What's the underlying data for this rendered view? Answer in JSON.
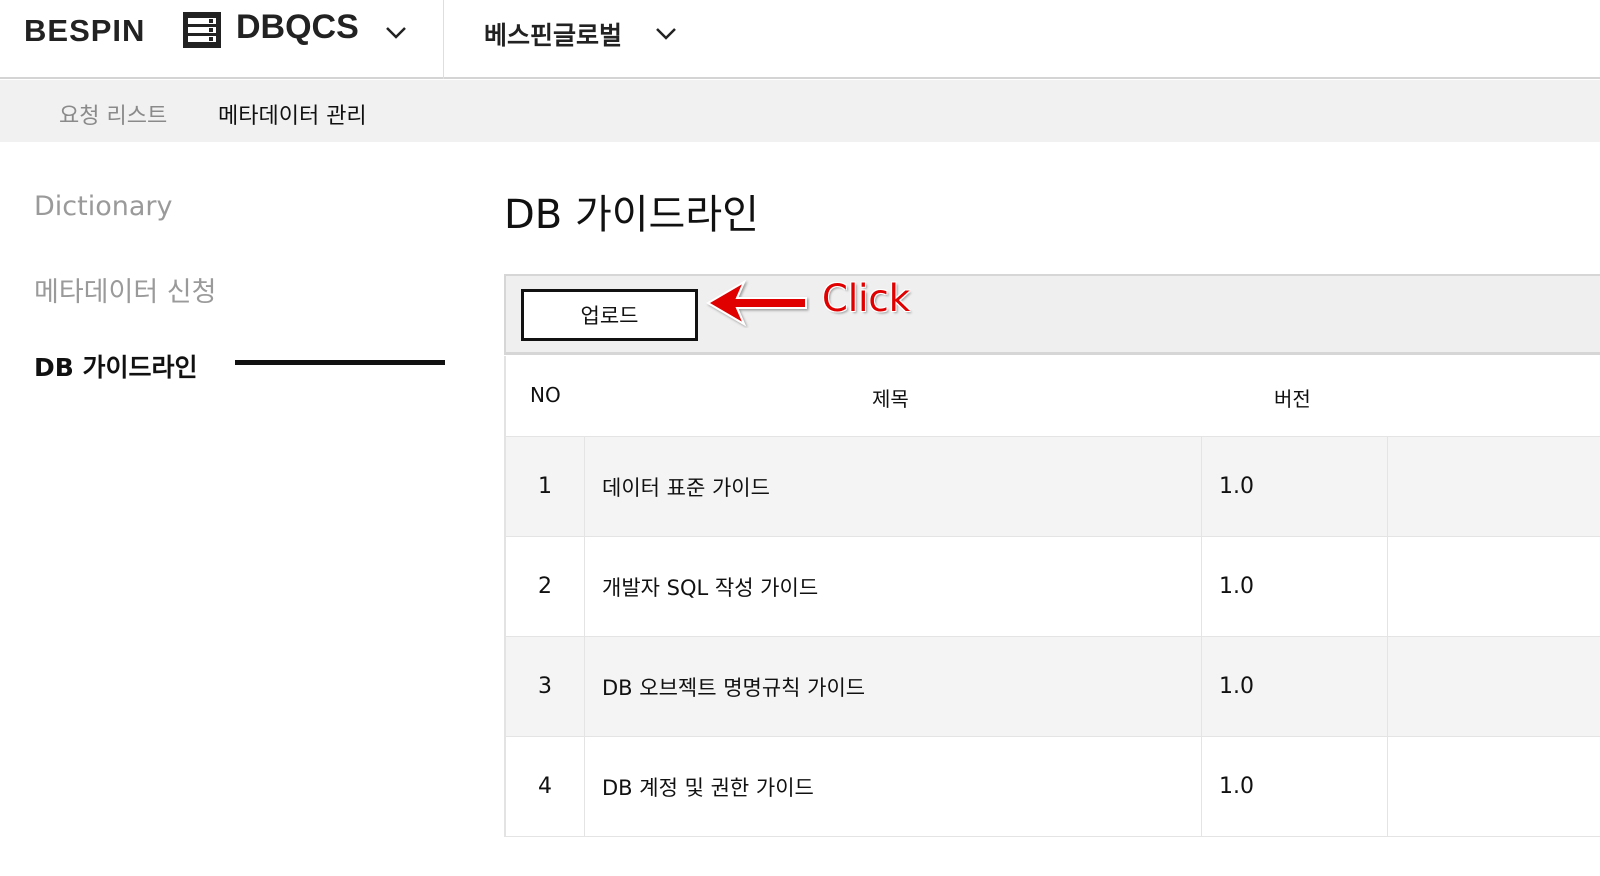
{
  "header": {
    "logo": "BESPIN",
    "product": "DBQCS",
    "org": "베스핀글로벌",
    "icons": [
      "server-icon",
      "chevron-down-icon"
    ]
  },
  "subnav": {
    "items": [
      {
        "label": "요청 리스트",
        "active": false
      },
      {
        "label": "메타데이터 관리",
        "active": true
      }
    ]
  },
  "sidebar": {
    "items": [
      {
        "label": "Dictionary",
        "active": false
      },
      {
        "label": "메타데이터 신청",
        "active": false
      },
      {
        "label": "DB 가이드라인",
        "active": true
      }
    ]
  },
  "main": {
    "title": "DB 가이드라인",
    "upload_label": "업로드",
    "annotation": "Click",
    "table": {
      "columns": [
        "NO",
        "제목",
        "버전"
      ],
      "rows": [
        {
          "no": "1",
          "title": "데이터 표준 가이드",
          "version": "1.0"
        },
        {
          "no": "2",
          "title": "개발자 SQL 작성 가이드",
          "version": "1.0"
        },
        {
          "no": "3",
          "title": "DB 오브젝트 명명규칙 가이드",
          "version": "1.0"
        },
        {
          "no": "4",
          "title": "DB 계정 및 권한 가이드",
          "version": "1.0"
        }
      ]
    }
  },
  "colors": {
    "accent": "#111111",
    "annotation": "#e00000",
    "inactive_text": "#9a9a9a",
    "subnav_bg": "#f1f1f1"
  }
}
